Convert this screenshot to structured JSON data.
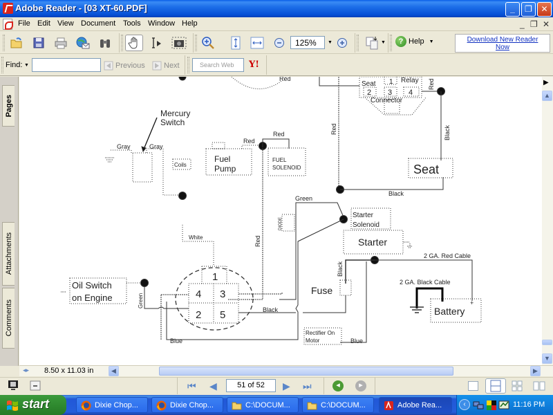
{
  "window": {
    "title": "Adobe Reader - [03 XT-60.PDF]",
    "controls": {
      "minimize": "_",
      "restore": "❐",
      "close": "✕"
    }
  },
  "menubar": {
    "items": [
      "File",
      "Edit",
      "View",
      "Document",
      "Tools",
      "Window",
      "Help"
    ],
    "doc_controls": {
      "minimize": "_",
      "restore": "❐",
      "close": "✕"
    }
  },
  "toolbar": {
    "buttons": [
      "open-icon",
      "save-icon",
      "print-icon",
      "email-icon",
      "search-binoculars-icon",
      "hand-tool-icon",
      "select-text-icon",
      "snapshot-icon",
      "zoom-in-tool-icon",
      "fit-page-icon",
      "fit-width-icon",
      "zoom-out-icon",
      "zoom-plus-icon",
      "rotate-pages-icon",
      "help-icon"
    ],
    "zoom_value": "125%",
    "help_label": "Help",
    "download_line1": "Download New Reader",
    "download_line2": "Now"
  },
  "findbar": {
    "find_label": "Find:",
    "find_value": "",
    "previous_label": "Previous",
    "next_label": "Next",
    "search_web_placeholder": "Search Web",
    "yahoo_label": "Y!"
  },
  "navpanel": {
    "tabs": [
      "Pages",
      "Attachments",
      "Comments"
    ]
  },
  "diagram": {
    "labels": {
      "mercury_switch_1": "Mercury",
      "mercury_switch_2": "Switch",
      "gray_left": "Gray",
      "gray_right": "Gray",
      "coils": "Coils",
      "fuel_pump_1": "Fuel",
      "fuel_pump_2": "Pump",
      "red_pump": "Red",
      "red_solenoid": "Red",
      "fuel_solenoid_1": "FUEL",
      "fuel_solenoid_2": "SOLENOID",
      "red_top": "Red",
      "seat_conn": "Seat",
      "relay": "Relay",
      "connector": "Connector",
      "pin1_top": "1",
      "pin2_top": "2",
      "pin3_top": "3",
      "pin4_top": "4",
      "red_relay": "Red",
      "red_vertical_left": "Red",
      "black_vertical": "Black",
      "seat": "Seat",
      "black_bottom": "Black",
      "green_top": "Green",
      "diode": "DIODE",
      "starter_solenoid_1": "Starter",
      "starter_solenoid_2": "Solenoid",
      "starter": "Starter",
      "white": "White",
      "red_mid": "Red",
      "cable_red": "2 GA. Red Cable",
      "cable_black": "2 GA. Black Cable",
      "black_fuse": "Black",
      "fuse": "Fuse",
      "battery": "Battery",
      "oil_switch_1": "Oil Switch",
      "oil_switch_2": "on Engine",
      "green_left": "Green",
      "key_pin1": "1",
      "key_pin4": "4",
      "key_pin3": "3",
      "key_pin2": "2",
      "key_pin5": "5",
      "black_key": "Black",
      "blue_left": "Blue",
      "rectifier_1": "Rectifier On",
      "rectifier_2": "Motor",
      "blue_right": "Blue",
      "plus": "+"
    }
  },
  "status": {
    "page_size": "8.50 x 11.03 in",
    "page_indicator": "51 of 52"
  },
  "taskbar": {
    "start_label": "start",
    "tasks": [
      {
        "label": "Dixie Chop...",
        "icon": "firefox-icon"
      },
      {
        "label": "Dixie Chop...",
        "icon": "firefox-icon"
      },
      {
        "label": "C:\\DOCUM...",
        "icon": "folder-icon"
      },
      {
        "label": "C:\\DOCUM...",
        "icon": "folder-icon"
      },
      {
        "label": "Adobe Rea...",
        "icon": "adobe-reader-icon"
      }
    ],
    "clock": "11:16 PM"
  }
}
